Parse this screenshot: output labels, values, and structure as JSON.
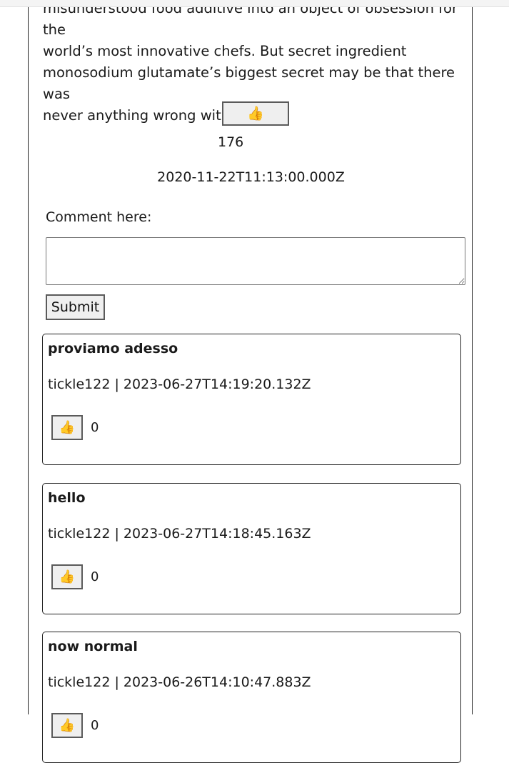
{
  "article": {
    "body_lines": [
      "misunderstood food additive into an object of obsession for the",
      "world’s most innovative chefs. But secret ingredient",
      "monosodium glutamate’s biggest secret may be that there was",
      "never anything wrong with it at all."
    ],
    "like_icon": "👍",
    "likes": "176",
    "date": "2020-11-22T11:13:00.000Z"
  },
  "comment_form": {
    "label": "Comment here:",
    "value": "",
    "submit_label": "Submit"
  },
  "comments": [
    {
      "title": "proviamo adesso",
      "user": "tickle122",
      "timestamp": "2023-06-27T14:19:20.132Z",
      "meta": "tickle122 | 2023-06-27T14:19:20.132Z",
      "like_icon": "👍",
      "likes": "0"
    },
    {
      "title": "hello",
      "user": "tickle122",
      "timestamp": "2023-06-27T14:18:45.163Z",
      "meta": "tickle122 | 2023-06-27T14:18:45.163Z",
      "like_icon": "👍",
      "likes": "0"
    },
    {
      "title": "now normal",
      "user": "tickle122",
      "timestamp": "2023-06-26T14:10:47.883Z",
      "meta": "tickle122 | 2023-06-26T14:10:47.883Z",
      "like_icon": "👍",
      "likes": "0"
    }
  ]
}
